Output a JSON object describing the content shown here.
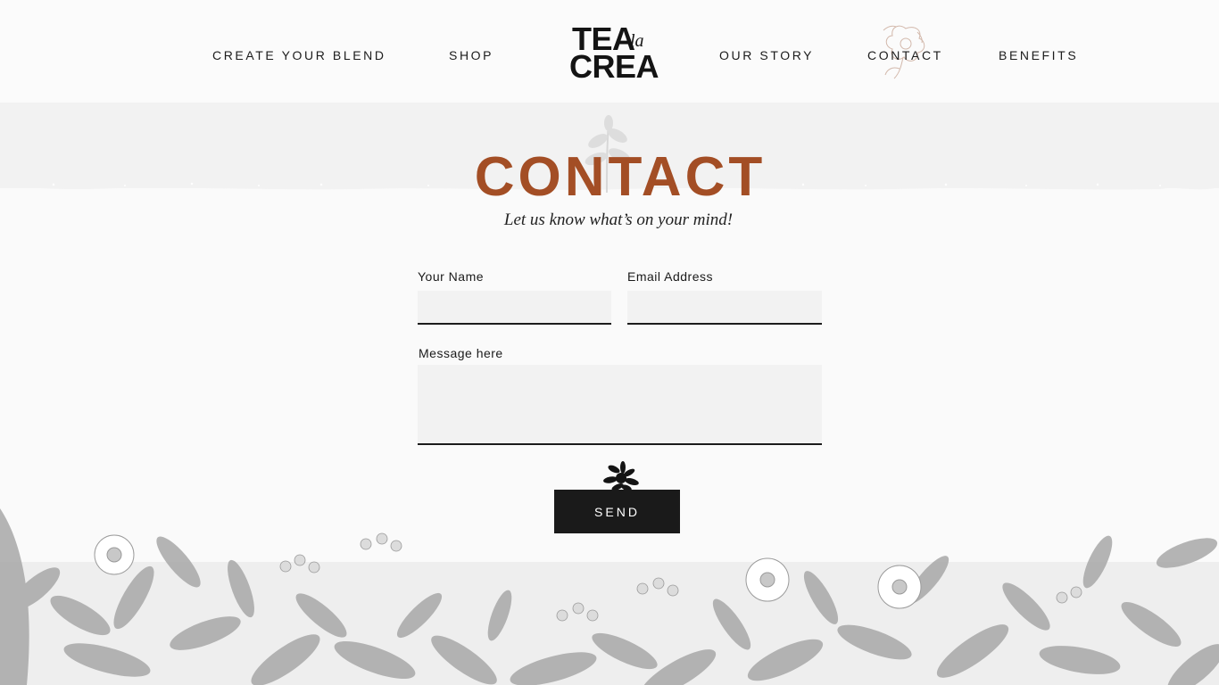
{
  "nav": {
    "create_blend": "CREATE YOUR BLEND",
    "shop": "SHOP",
    "our_story": "OUR STORY",
    "contact": "CONTACT",
    "benefits": "BENEFITS"
  },
  "logo": {
    "line1": "TEA",
    "script": "la",
    "line2": "CREA"
  },
  "hero": {
    "title": "CONTACT",
    "subtitle": "Let us know what’s on your mind!"
  },
  "form": {
    "name_label": "Your Name",
    "name_value": "",
    "email_label": "Email Address",
    "email_value": "",
    "message_label": "Message here",
    "message_value": "",
    "send_label": "SEND"
  },
  "icons": {
    "header_decoration": "flower-sketch-icon",
    "hero_decoration": "leaf-sprig-icon",
    "send_decoration": "leaf-cluster-icon",
    "footer_decoration": "botanical-illustration"
  },
  "colors": {
    "accent": "#a34e25",
    "text": "#1a1a1a",
    "field_bg": "#f2f2f2",
    "button_bg": "#1a1a1a",
    "page_bg": "#fafafa",
    "band_bg": "#f2f2f2"
  }
}
